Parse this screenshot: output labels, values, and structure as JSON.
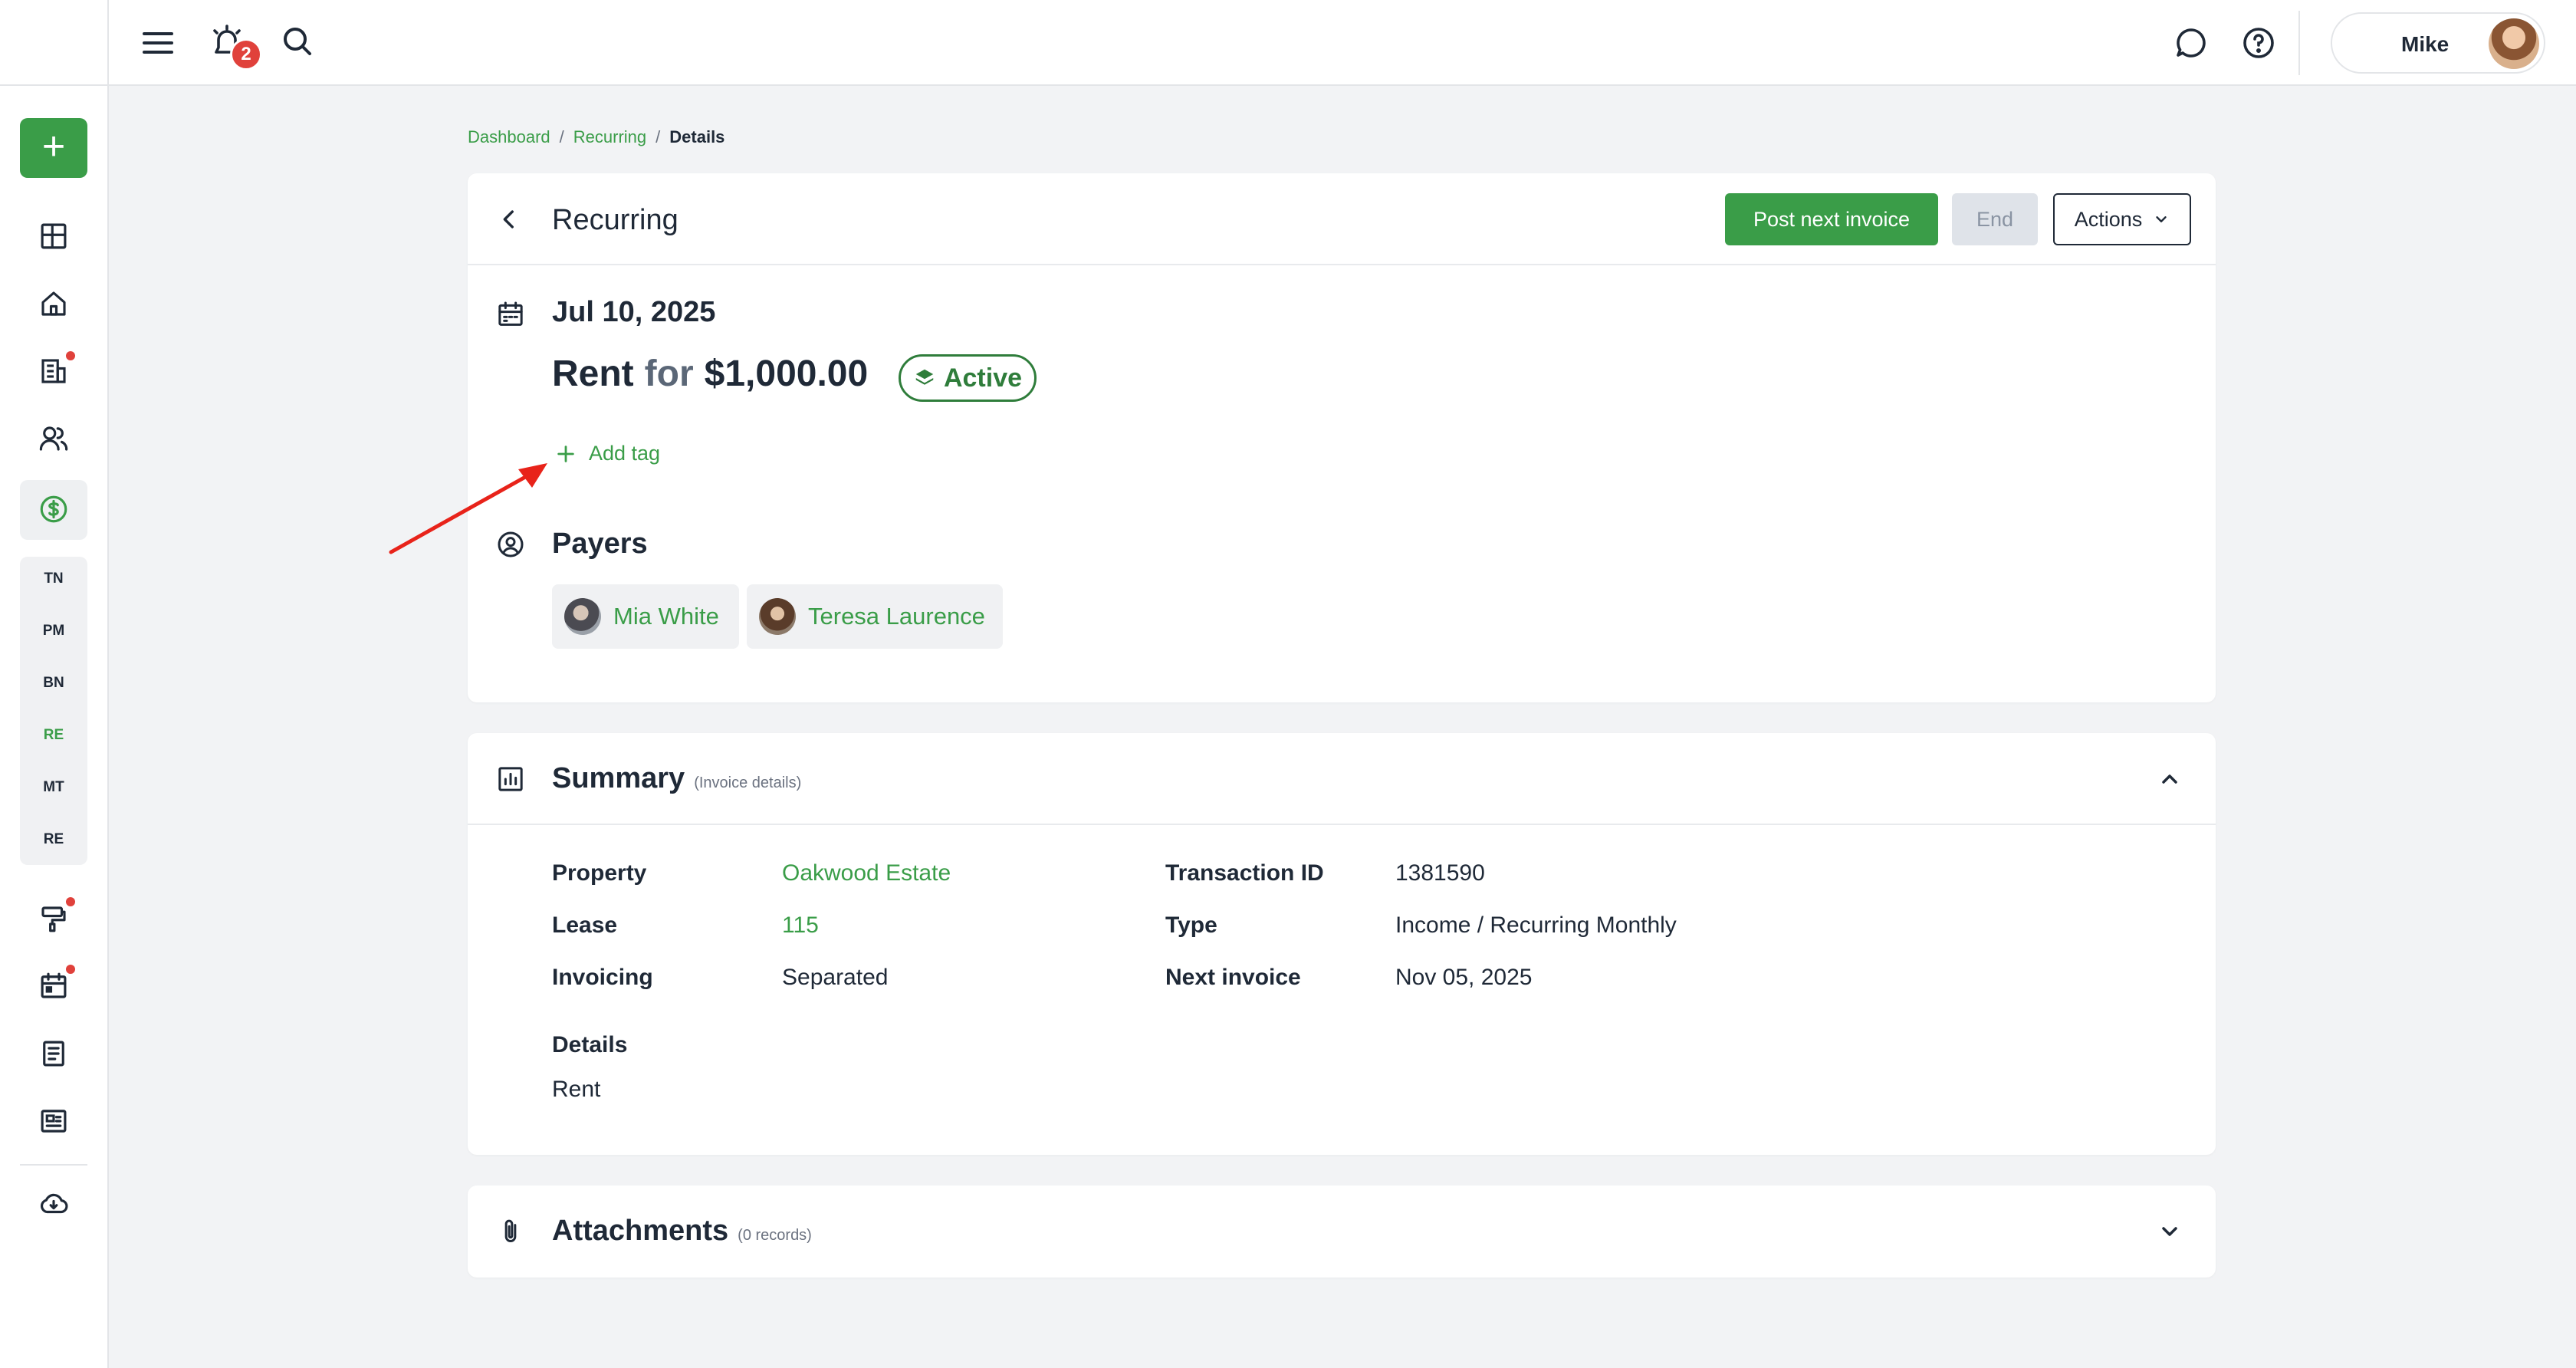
{
  "topbar": {
    "notification_count": "2",
    "user_name": "Mike"
  },
  "sidebar": {
    "codes": [
      "TN",
      "PM",
      "BN",
      "RE",
      "MT",
      "RE"
    ],
    "active_code_index": 3
  },
  "breadcrumb": {
    "items": [
      "Dashboard",
      "Recurring"
    ],
    "current": "Details",
    "separator": "/"
  },
  "header": {
    "title": "Recurring",
    "post_label": "Post next invoice",
    "end_label": "End",
    "actions_label": "Actions"
  },
  "recurring": {
    "date": "Jul 10, 2025",
    "category": "Rent",
    "for_word": "for",
    "amount": "$1,000.00",
    "status": "Active",
    "add_tag_label": "Add tag"
  },
  "payers": {
    "title": "Payers",
    "items": [
      {
        "name": "Mia White"
      },
      {
        "name": "Teresa Laurence"
      }
    ]
  },
  "summary": {
    "title": "Summary",
    "subtitle": "(Invoice details)",
    "property_label": "Property",
    "property_value": "Oakwood Estate",
    "lease_label": "Lease",
    "lease_value": "115",
    "invoicing_label": "Invoicing",
    "invoicing_value": "Separated",
    "transaction_label": "Transaction ID",
    "transaction_value": "1381590",
    "type_label": "Type",
    "type_value": "Income / Recurring Monthly",
    "next_invoice_label": "Next invoice",
    "next_invoice_value": "Nov 05, 2025",
    "details_label": "Details",
    "details_value": "Rent"
  },
  "attachments": {
    "title": "Attachments",
    "subtitle": "(0 records)"
  },
  "colors": {
    "brand_green": "#3a9d48",
    "status_green": "#2f7d3b",
    "alert_red": "#e0413b",
    "annotation_red": "#e8231a"
  }
}
